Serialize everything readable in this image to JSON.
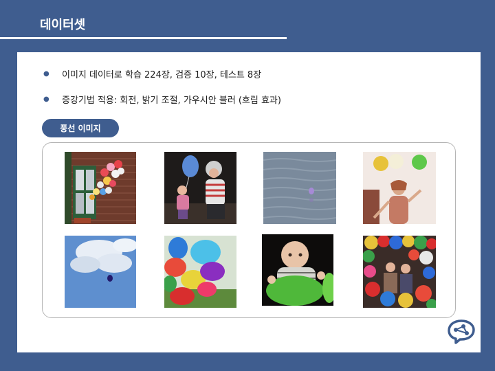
{
  "slide": {
    "title": "데이터셋",
    "bullets": [
      "이미지 데이터로 학습 224장, 검증 10장, 테스트 8장",
      "증강기법 적용: 회전, 밝기 조절, 가우시안 블러 (흐림 효과)"
    ],
    "section_label": "풍선 이미지"
  },
  "images": [
    {
      "name": "balloons-brick-wall-window"
    },
    {
      "name": "grandmother-child-balloon"
    },
    {
      "name": "balloon-over-water"
    },
    {
      "name": "girl-with-balloons-bright"
    },
    {
      "name": "balloon-in-cloudy-sky"
    },
    {
      "name": "colorful-balloons-cluster"
    },
    {
      "name": "baby-with-green-balloon"
    },
    {
      "name": "people-in-balloon-room"
    }
  ],
  "colors": {
    "background": "#3f5d8f",
    "panel": "#ffffff",
    "accent": "#3f5d8f"
  },
  "icons": {
    "logo": "brain-network-icon"
  }
}
